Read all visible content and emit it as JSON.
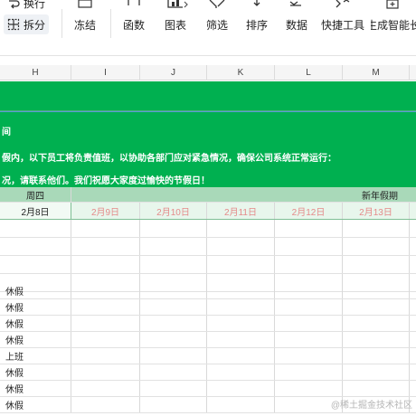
{
  "toolbar": {
    "left": [
      {
        "label": "换行",
        "icon": "wrap-text-icon"
      },
      {
        "label": "拆分",
        "icon": "split-cells-icon"
      }
    ],
    "buttons": [
      {
        "label": "冻结",
        "icon": "freeze-panes-icon"
      },
      {
        "label": "函数",
        "icon": "function-icon"
      },
      {
        "label": "图表",
        "icon": "chart-icon"
      },
      {
        "label": "筛选",
        "icon": "filter-icon"
      },
      {
        "label": "排序",
        "icon": "sort-icon"
      },
      {
        "label": "数据",
        "icon": "data-icon"
      },
      {
        "label": "快捷工具",
        "icon": "quick-tools-icon"
      },
      {
        "label": "生成智能长",
        "icon": "smart-generate-icon"
      }
    ]
  },
  "columns": [
    "H",
    "I",
    "J",
    "K",
    "L",
    "M"
  ],
  "banner": {
    "line1": "间",
    "line2": "假内，以下员工将负责值班，以协助各部门应对紧急情况，确保公司系统正常运行：",
    "line3": "况，请联系他们。我们祝愿大家度过愉快的节假日！"
  },
  "header_row": {
    "weekday": "周四",
    "holiday_label": "新年假期"
  },
  "date_row": {
    "h_date": "2月8日",
    "holiday_dates": [
      "2月9日",
      "2月10日",
      "2月11日",
      "2月12日",
      "2月13日"
    ]
  },
  "status_rows": [
    "休假",
    "休假",
    "休假",
    "休假",
    "上班",
    "休假",
    "休假",
    "休假"
  ],
  "watermark": "@稀土掘金技术社区",
  "colors": {
    "banner_green": "#00b050",
    "header_green": "#a9d9b9",
    "holiday_date_red": "#e58a8a"
  }
}
